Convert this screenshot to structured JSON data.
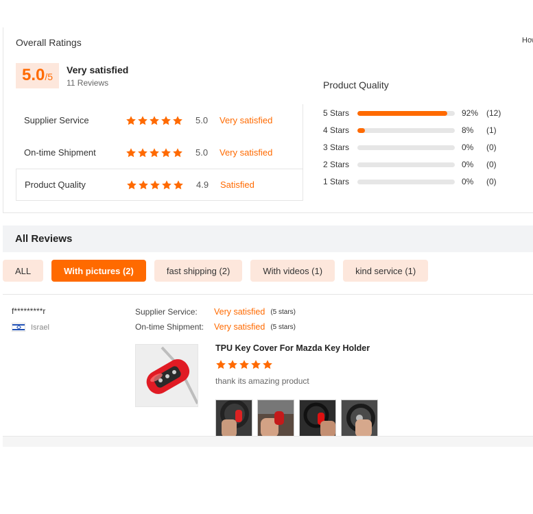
{
  "overall": {
    "title": "Overall Ratings",
    "corner_text": "How",
    "score": "5.0",
    "score_max": "/5",
    "satisfaction": "Very satisfied",
    "reviews_count": "11 Reviews"
  },
  "dimensions": [
    {
      "label": "Supplier Service",
      "score": "5.0",
      "text": "Very satisfied",
      "stars": 5
    },
    {
      "label": "On-time Shipment",
      "score": "5.0",
      "text": "Very satisfied",
      "stars": 5
    },
    {
      "label": "Product Quality",
      "score": "4.9",
      "text": "Satisfied",
      "stars": 5
    }
  ],
  "quality": {
    "title": "Product Quality",
    "rows": [
      {
        "label": "5  Stars",
        "pct": "92%",
        "count": "(12)",
        "fill": 0.92
      },
      {
        "label": "4  Stars",
        "pct": "8%",
        "count": "(1)",
        "fill": 0.08
      },
      {
        "label": "3  Stars",
        "pct": "0%",
        "count": "(0)",
        "fill": 0
      },
      {
        "label": "2  Stars",
        "pct": "0%",
        "count": "(0)",
        "fill": 0
      },
      {
        "label": "1  Stars",
        "pct": "0%",
        "count": "(0)",
        "fill": 0
      }
    ]
  },
  "all_reviews": {
    "title": "All Reviews",
    "filters": [
      "ALL",
      "With pictures (2)",
      "fast shipping (2)",
      "With videos (1)",
      "kind service (1)"
    ],
    "active_filter": "With pictures (2)"
  },
  "review": {
    "reviewer": "f*********r",
    "country": "Israel",
    "supplier_label": "Supplier Service:",
    "supplier_value": "Very satisfied",
    "supplier_stars": "(5 stars)",
    "shipment_label": "On-time Shipment:",
    "shipment_value": "Very satisfied",
    "shipment_stars": "(5 stars)",
    "product_name": "TPU Key Cover For Mazda Key Holder",
    "rating": 5,
    "text": "thank its amazing product",
    "photo_count": 4
  },
  "colors": {
    "accent": "#ff6a00",
    "chip_bg": "#fde7dc",
    "section_bg": "#f2f3f5",
    "bar_track": "#e6e6e6"
  }
}
